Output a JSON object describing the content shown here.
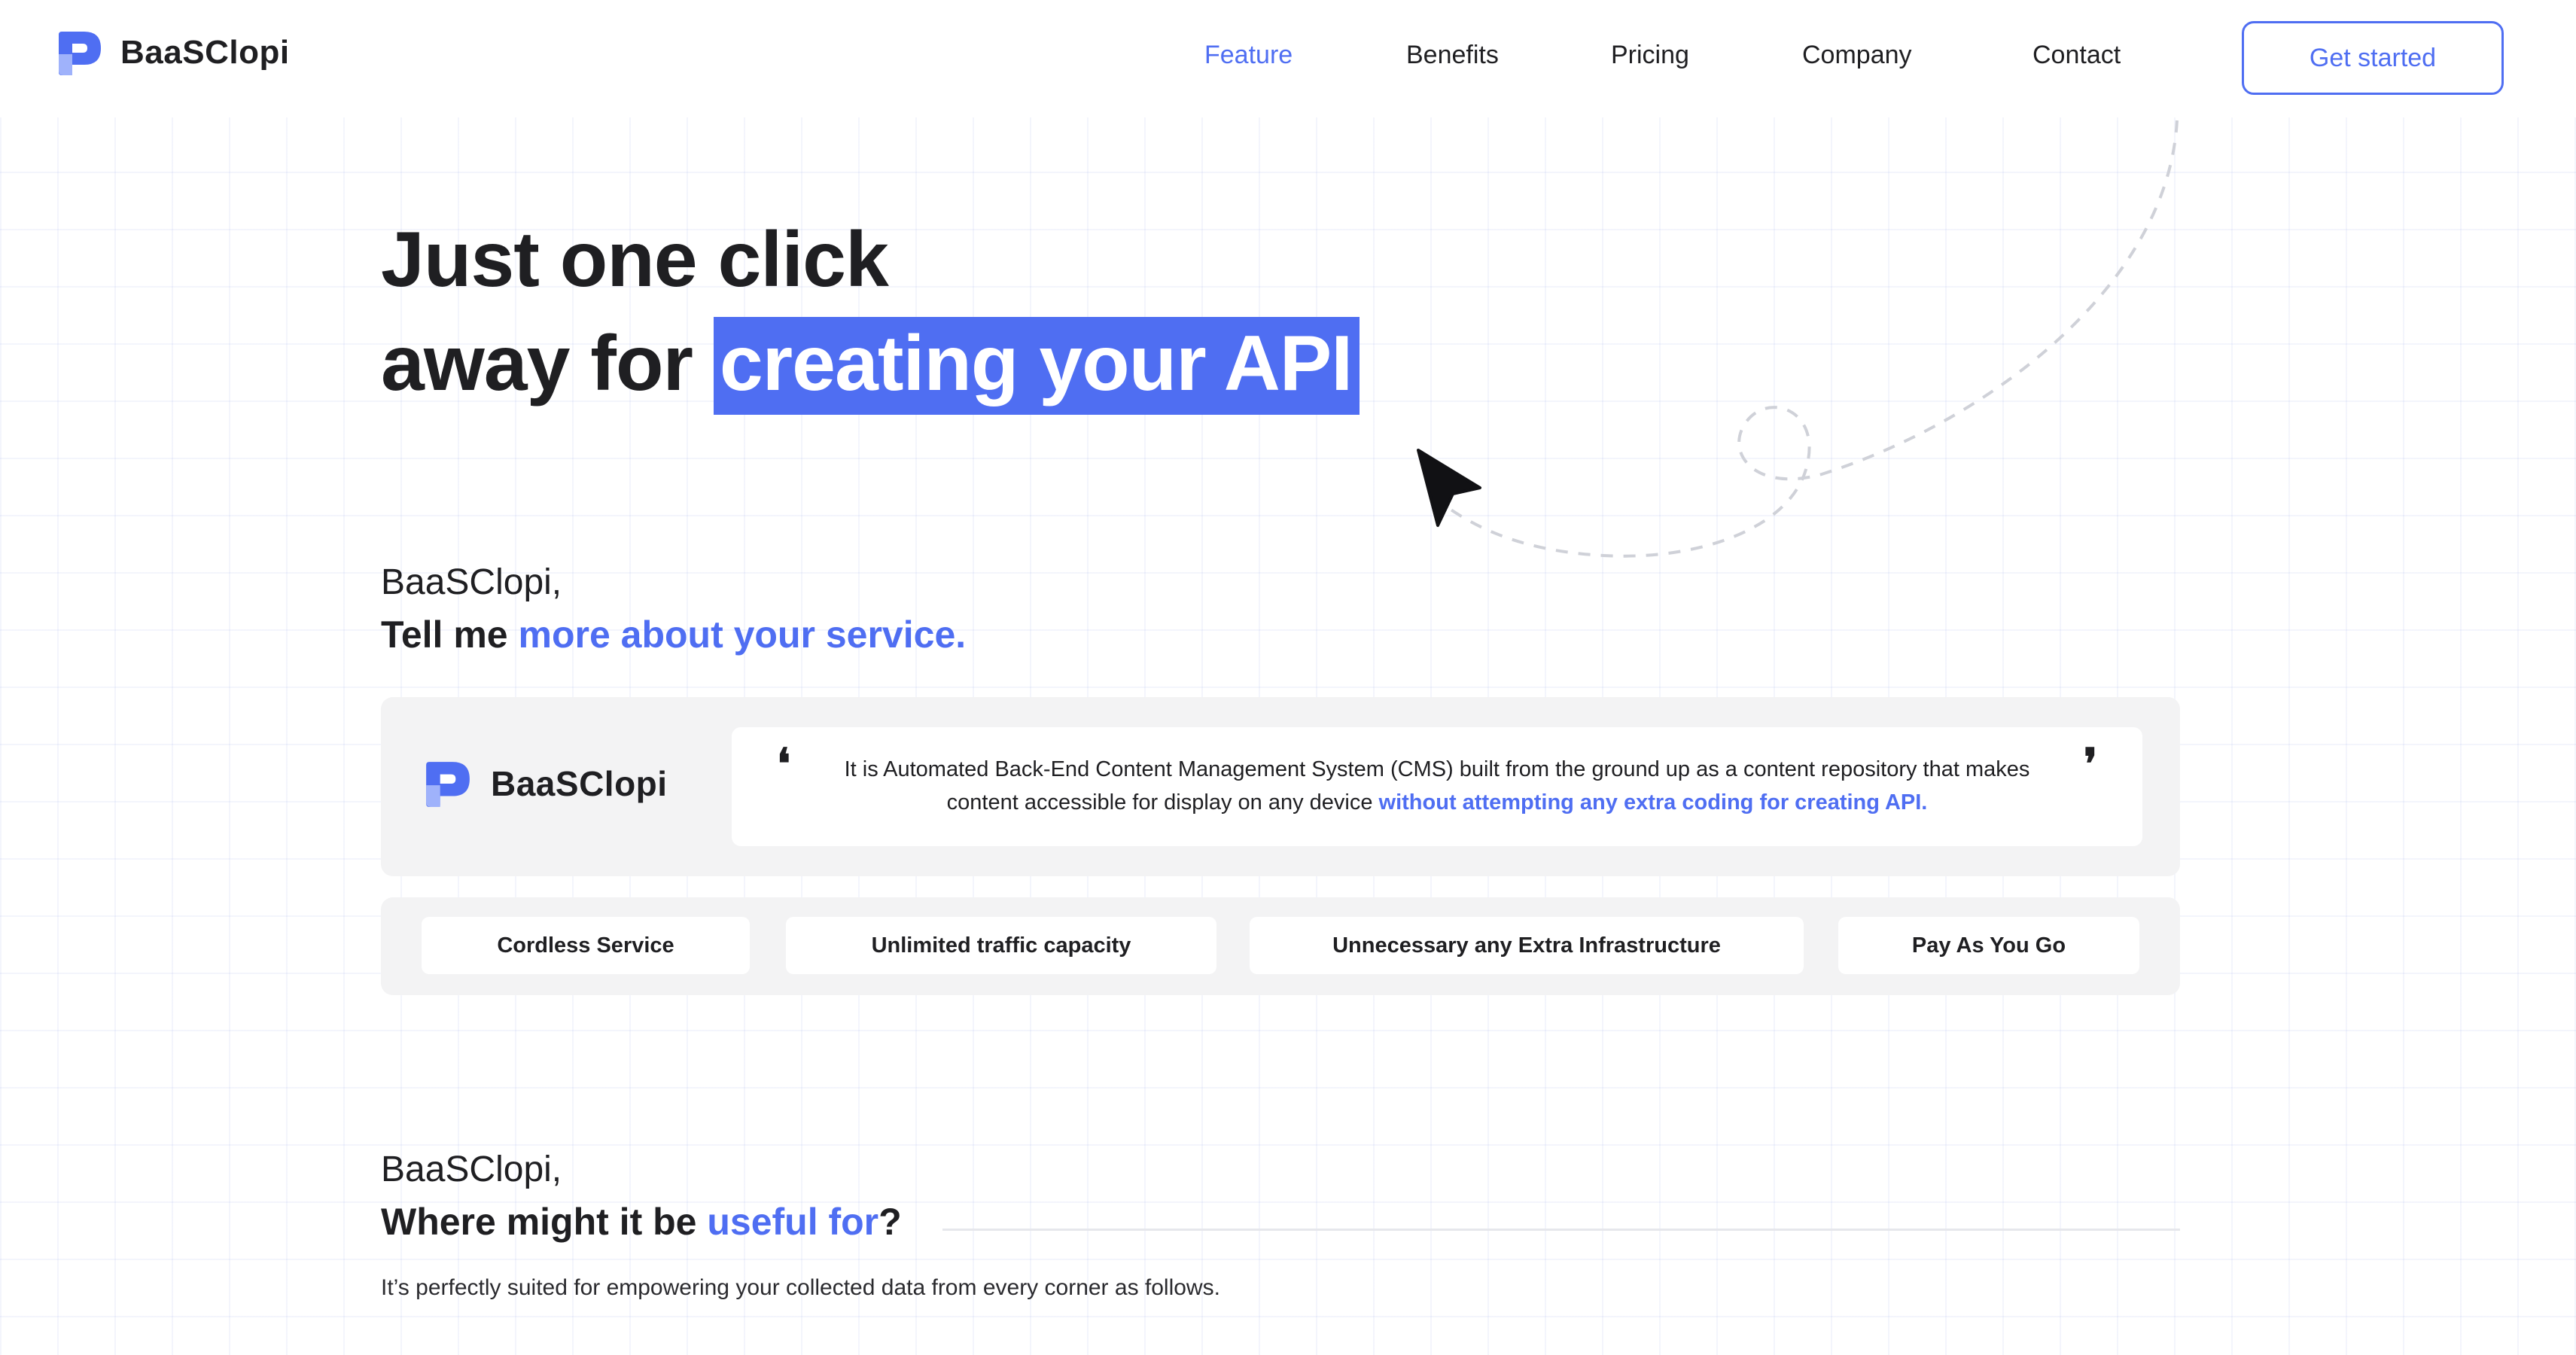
{
  "brand": {
    "name": "BaaSClopi",
    "accent": "#4f6ef2"
  },
  "nav": {
    "items": [
      {
        "label": "Feature",
        "active": true
      },
      {
        "label": "Benefits",
        "active": false
      },
      {
        "label": "Pricing",
        "active": false
      },
      {
        "label": "Company",
        "active": false
      },
      {
        "label": "Contact",
        "active": false
      }
    ],
    "cta_label": "Get started"
  },
  "hero": {
    "line1": "Just one click",
    "line2_prefix": "away for ",
    "line2_highlight": "creating your API",
    "cursor_icon": "arrow-cursor-icon"
  },
  "about": {
    "greeting": "BaaSClopi,",
    "heading_prefix": "Tell me ",
    "heading_accent": "more about your service.",
    "card_brand": "BaaSClopi",
    "quote_open": "❛",
    "quote_close": "❜",
    "quote_text": "It is Automated Back-End Content Management System (CMS) built from the ground up as a content repository that makes content accessible for display on any device ",
    "quote_accent": "without attempting any extra coding for creating API."
  },
  "features": [
    "Cordless Service",
    "Unlimited traffic capacity",
    "Unnecessary any Extra Infrastructure",
    "Pay As You Go"
  ],
  "use": {
    "greeting": "BaaSClopi,",
    "heading_prefix": "Where might it be ",
    "heading_accent": "useful for",
    "heading_suffix": "?",
    "description": "It’s perfectly suited for empowering your collected data from every corner as follows."
  }
}
